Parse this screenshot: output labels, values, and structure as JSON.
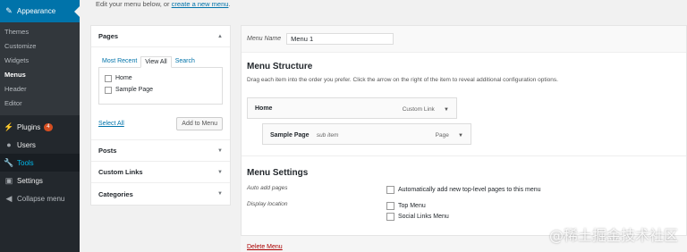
{
  "sidebar": {
    "appearance": "Appearance",
    "sub": [
      "Themes",
      "Customize",
      "Widgets",
      "Menus",
      "Header",
      "Editor"
    ],
    "plugins": "Plugins",
    "plugins_badge": "4",
    "users": "Users",
    "tools": "Tools",
    "settings": "Settings",
    "collapse": "Collapse menu"
  },
  "header": {
    "instruction": "Edit your menu below, or",
    "create_link": "create a new menu"
  },
  "left": {
    "pages_title": "Pages",
    "tabs": [
      "Most Recent",
      "View All",
      "Search"
    ],
    "pages": [
      "Home",
      "Sample Page"
    ],
    "select_all": "Select All",
    "add_button": "Add to Menu",
    "sections": [
      "Posts",
      "Custom Links",
      "Categories"
    ]
  },
  "editor": {
    "name_label": "Menu Name",
    "name_value": "Menu 1",
    "structure_title": "Menu Structure",
    "structure_desc": "Drag each item into the order you prefer. Click the arrow on the right of the item to reveal additional configuration options.",
    "items": [
      {
        "title": "Home",
        "sub": "",
        "type": "Custom Link"
      },
      {
        "title": "Sample Page",
        "sub": "sub item",
        "type": "Page"
      }
    ],
    "settings_title": "Menu Settings",
    "auto_add_label": "Auto add pages",
    "auto_add_option": "Automatically add new top-level pages to this menu",
    "display_label": "Display location",
    "locations": [
      "Top Menu",
      "Social Links Menu"
    ],
    "delete_link": "Delete Menu"
  },
  "watermark": "@稀土掘金技术社区",
  "colors": {
    "sidebar_bg": "#23282d",
    "accent": "#0073aa",
    "active_hover": "#00b9eb",
    "badge": "#d54e21",
    "delete": "#aa0000"
  }
}
